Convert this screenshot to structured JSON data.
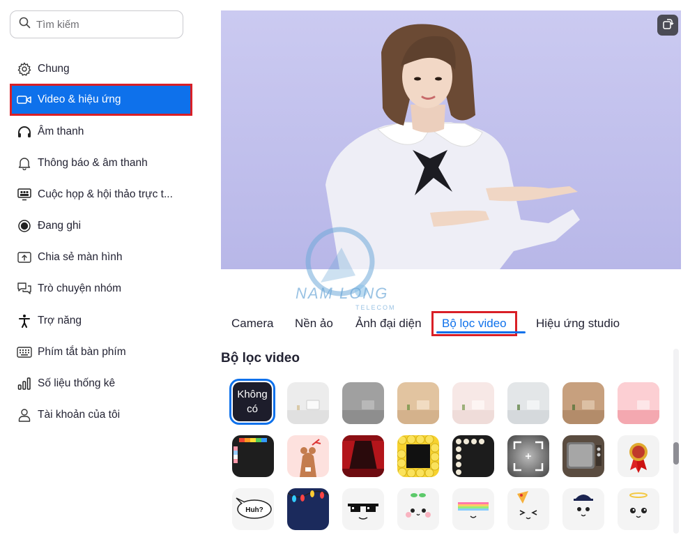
{
  "search": {
    "placeholder": "Tìm kiếm"
  },
  "sidebar": {
    "items": [
      {
        "label": "Chung",
        "icon": "gear-icon"
      },
      {
        "label": "Video & hiệu ứng",
        "icon": "video-camera-icon",
        "active": true
      },
      {
        "label": "Âm thanh",
        "icon": "headphones-icon"
      },
      {
        "label": "Thông báo & âm thanh",
        "icon": "bell-icon"
      },
      {
        "label": "Cuộc họp & hội thảo trực t...",
        "icon": "meeting-icon"
      },
      {
        "label": "Đang ghi",
        "icon": "record-icon"
      },
      {
        "label": "Chia sẻ màn hình",
        "icon": "share-screen-icon"
      },
      {
        "label": "Trò chuyện nhóm",
        "icon": "chat-icon"
      },
      {
        "label": "Trợ năng",
        "icon": "accessibility-icon"
      },
      {
        "label": "Phím tắt bàn phím",
        "icon": "keyboard-icon"
      },
      {
        "label": "Số liệu thống kê",
        "icon": "statistics-icon"
      },
      {
        "label": "Tài khoản của tôi",
        "icon": "account-icon"
      }
    ]
  },
  "watermark": {
    "brand": "NAM LONG",
    "sub": "TELECOM"
  },
  "tabs": [
    {
      "label": "Camera"
    },
    {
      "label": "Nền ảo"
    },
    {
      "label": "Ảnh đại diện"
    },
    {
      "label": "Bộ lọc video",
      "active": true
    },
    {
      "label": "Hiệu ứng studio"
    }
  ],
  "section": {
    "title": "Bộ lọc video"
  },
  "filters": {
    "none_label_line1": "Không",
    "none_label_line2": "có",
    "speech_bubble_text": "Huh?",
    "items": [
      "none",
      "white-room",
      "gray-room",
      "beige-room",
      "pink-room",
      "light-room",
      "brown-room",
      "rose-room",
      "tv-color-bars",
      "reindeer",
      "theater-curtain",
      "emoji-frame",
      "film-strip",
      "focus-frame",
      "retro-tv",
      "rosette-badge",
      "speech-bubble",
      "christmas-lights",
      "pixel-sunglasses",
      "sprout-face",
      "rainbow-visor",
      "pizza-face",
      "cap-face",
      "halo-face"
    ]
  },
  "colors": {
    "accent": "#0e71eb",
    "highlight": "#d91f26",
    "preview_bg": "#c5c4ee"
  }
}
